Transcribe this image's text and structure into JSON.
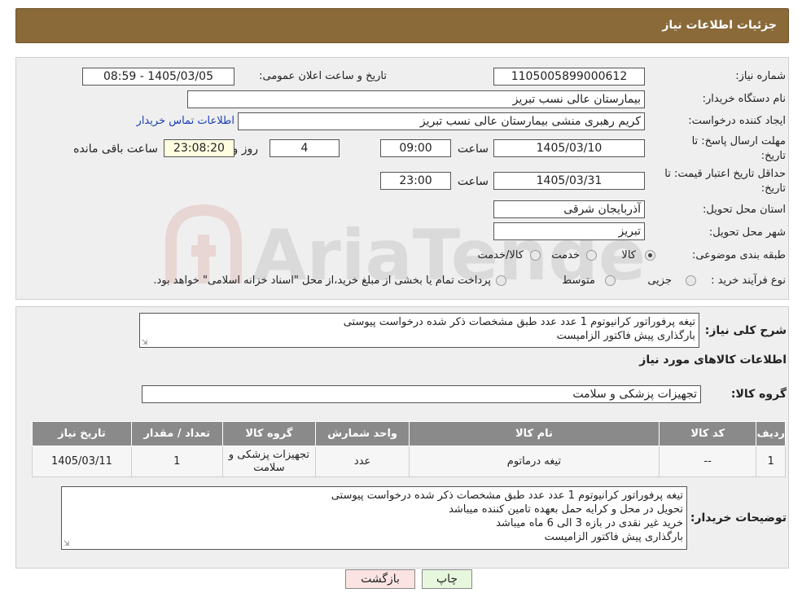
{
  "header": {
    "title": "جزئیات اطلاعات نیاز"
  },
  "info": {
    "need_number_label": "شماره نیاز:",
    "need_number": "1105005899000612",
    "announce_label": "تاریخ و ساعت اعلان عمومی:",
    "announce_value": "1405/03/05 - 08:59",
    "buyer_org_label": "نام دستگاه خریدار:",
    "buyer_org": "بیمارستان عالی نسب تبریز",
    "requester_label": "ایجاد کننده درخواست:",
    "requester": "کریم رهبری منشی بیمارستان عالی نسب تبریز",
    "contact_link": "اطلاعات تماس خریدار",
    "deadline_label_1": "مهلت ارسال پاسخ: تا",
    "deadline_label_2": "تاریخ:",
    "deadline_date": "1405/03/10",
    "time_label": "ساعت",
    "deadline_time": "09:00",
    "days_value": "4",
    "days_label": "روز و",
    "remaining_time": "23:08:20",
    "remaining_label": "ساعت باقی مانده",
    "validity_label_1": "حداقل تاریخ اعتبار قیمت: تا",
    "validity_label_2": "تاریخ:",
    "validity_date": "1405/03/31",
    "validity_time": "23:00",
    "province_label": "استان محل تحویل:",
    "province": "آذربایجان شرقی",
    "city_label": "شهر محل تحویل:",
    "city": "تبریز",
    "category_label": "طبقه بندی موضوعی:",
    "category_options": [
      "کالا",
      "خدمت",
      "کالا/خدمت"
    ],
    "purchase_type_label": "نوع فرآیند خرید :",
    "purchase_options": [
      "جزیی",
      "متوسط"
    ],
    "purchase_note": "پرداخت تمام یا بخشی از مبلغ خرید،از محل \"اسناد خزانه اسلامی\" خواهد بود."
  },
  "summary": {
    "desc_label": "شرح کلی نیاز:",
    "desc_lines": [
      "تیغه پرفوراتور کرانیوتوم 1 عدد عدد طبق مشخصات ذکر شده درخواست پیوستی",
      "بارگذاری پیش فاکتور الزامیست"
    ],
    "goods_info_title": "اطلاعات کالاهای مورد نیاز",
    "group_label": "گروه کالا:",
    "group_value": "تجهیزات پزشکی و سلامت"
  },
  "table": {
    "headers": [
      "ردیف",
      "کد کالا",
      "نام کالا",
      "واحد شمارش",
      "گروه کالا",
      "تعداد / مقدار",
      "تاریخ نیاز"
    ],
    "rows": [
      [
        "1",
        "--",
        "تیغه درماتوم",
        "عدد",
        "تجهیزات پزشکی و سلامت",
        "1",
        "1405/03/11"
      ]
    ]
  },
  "buyer_notes": {
    "label": "توضیحات خریدار:",
    "lines": [
      "تیغه پرفوراتور کرانیوتوم 1 عدد عدد طبق مشخصات ذکر شده درخواست پیوستی",
      "تحویل در محل و کرایه حمل بعهده تامین کننده میباشد",
      "خرید غیر نقدی در بازه 3 الی 6 ماه میباشد",
      "بارگذاری پیش فاکتور الزامیست"
    ]
  },
  "buttons": {
    "print": "چاپ",
    "back": "بازگشت"
  },
  "watermark_text": "AriaTender.neT",
  "colors": {
    "header": "#8b6a3a",
    "table_header": "#8a8a8a",
    "print_btn": "#e6f7dd",
    "back_btn": "#fbe3e3"
  }
}
